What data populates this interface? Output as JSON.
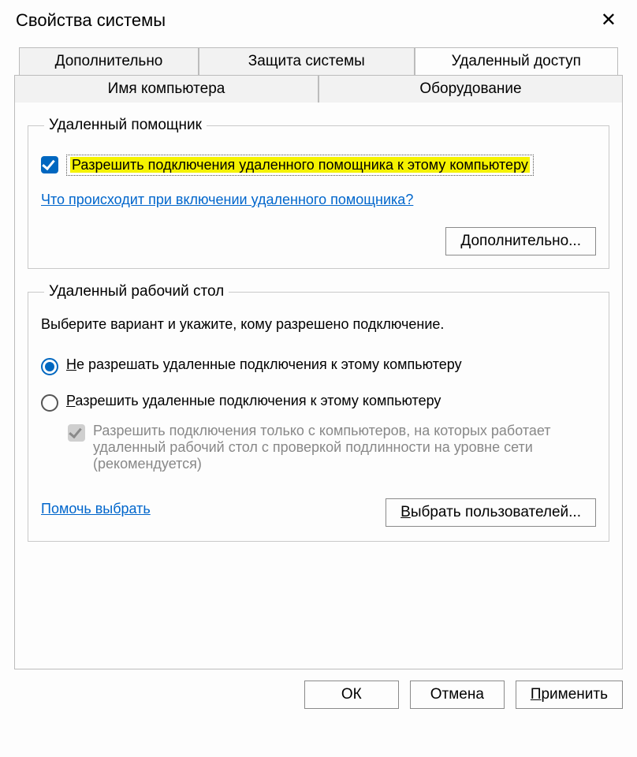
{
  "window": {
    "title": "Свойства системы",
    "close_icon": "✕"
  },
  "tabs": {
    "row1": [
      "Имя компьютера",
      "Оборудование"
    ],
    "row2": [
      "Дополнительно",
      "Защита системы",
      "Удаленный доступ"
    ],
    "active": "Удаленный доступ"
  },
  "assistant": {
    "legend": "Удаленный помощник",
    "checkbox_label": "Разрешить подключения удаленного помощника к этому компьютеру",
    "checkbox_checked": true,
    "help_link": "Что происходит при включении удаленного помощника?",
    "advanced_button": "Дополнительно..."
  },
  "rdp": {
    "legend": "Удаленный рабочий стол",
    "intro": "Выберите вариант и укажите, кому разрешено подключение.",
    "option_disallow": "Не разрешать удаленные подключения к этому компьютеру",
    "option_allow": "Разрешить удаленные подключения к этому компьютеру",
    "selected": "disallow",
    "nla_checkbox": "Разрешить подключения только с компьютеров, на которых работает удаленный рабочий стол с проверкой подлинности на уровне сети (рекомендуется)",
    "nla_checked": true,
    "nla_enabled": false,
    "help_link": "Помочь выбрать",
    "select_users_button": "Выбрать пользователей..."
  },
  "buttons": {
    "ok": "ОК",
    "cancel": "Отмена",
    "apply": "Применить"
  }
}
